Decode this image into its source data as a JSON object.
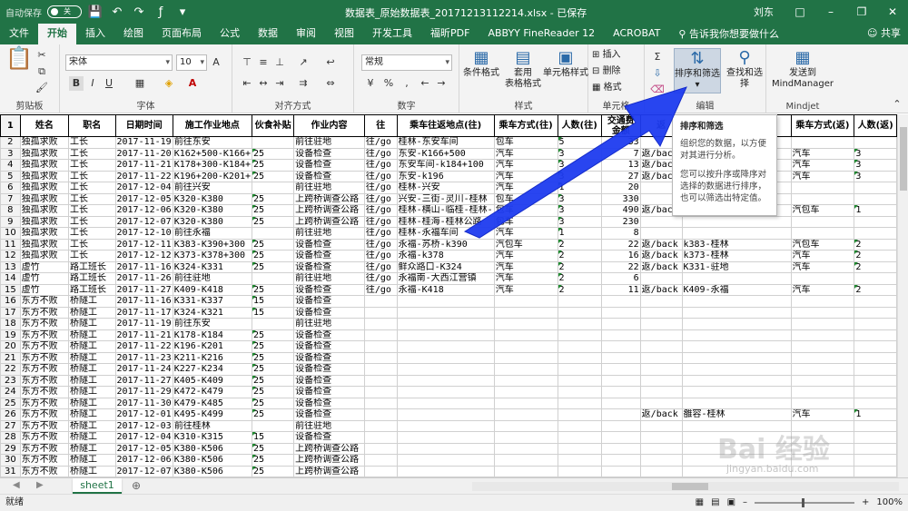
{
  "titlebar": {
    "autosave": "自动保存",
    "toggle": "关",
    "title": "数据表_原始数据表_20171213112214.xlsx - 已保存",
    "user": "刘东"
  },
  "tabs": [
    "文件",
    "开始",
    "插入",
    "绘图",
    "页面布局",
    "公式",
    "数据",
    "审阅",
    "视图",
    "开发工具",
    "福昕PDF",
    "ABBYY FineReader 12",
    "ACROBAT"
  ],
  "tellme": "告诉我你想要做什么",
  "share": "共享",
  "ribbon": {
    "clipboard": "剪贴板",
    "font": "字体",
    "font_name": "宋体",
    "font_size": "10",
    "alignment": "对齐方式",
    "number": "数字",
    "number_format": "常规",
    "styles": "样式",
    "cond_format": "条件格式",
    "table_format": "套用\n表格格式",
    "cell_style": "单元格样式",
    "cells": "单元格",
    "insert": "插入",
    "delete": "删除",
    "format": "格式",
    "edit": "编辑",
    "sort_filter": "排序和筛选",
    "find_select": "查找和选择",
    "mindjet": "Mindjet",
    "send_mm": "发送到\nMindManager"
  },
  "tooltip": {
    "title": "排序和筛选",
    "p1": "组织您的数据，以方便对其进行分析。",
    "p2": "您可以按升序或降序对选择的数据进行排序，也可以筛选出特定值。"
  },
  "headers": [
    "姓名",
    "职名",
    "日期时间",
    "施工作业地点",
    "伙食补贴",
    "作业内容",
    "往",
    "乘车往返地点(往)",
    "乘车方式(往)",
    "人数(往)",
    "交通费\n金额",
    "返",
    "",
    "乘车方式(返)",
    "人数(返)"
  ],
  "rows": [
    [
      "独孤求败",
      "工长",
      "2017-11-19",
      "前往东安",
      "",
      "前往驻地",
      "往/go",
      "桂林-东安车间",
      "包车",
      "5",
      "33",
      "",
      "",
      "",
      ""
    ],
    [
      "独孤求败",
      "工长",
      "2017-11-20",
      "K162+500-K166+",
      "25",
      "设备检查",
      "往/go",
      "东安-K166+500",
      "汽车",
      "3",
      "7",
      "返/back",
      "",
      "汽车",
      "3"
    ],
    [
      "独孤求败",
      "工长",
      "2017-11-21",
      "K178+300-K184+",
      "25",
      "设备检查",
      "往/go",
      "东安车间-k184+100",
      "汽车",
      "3",
      "13",
      "返/back",
      "",
      "汽车",
      "3"
    ],
    [
      "独孤求败",
      "工长",
      "2017-11-22",
      "K196+200-K201+",
      "25",
      "设备检查",
      "往/go",
      "东安-k196",
      "汽车",
      "3",
      "27",
      "返/back",
      "",
      "汽车",
      "3"
    ],
    [
      "独孤求败",
      "工长",
      "2017-12-04",
      "前往兴安",
      "",
      "前往驻地",
      "往/go",
      "桂林-兴安",
      "汽车",
      "1",
      "20",
      "",
      "",
      "",
      ""
    ],
    [
      "独孤求败",
      "工长",
      "2017-12-05",
      "K320-K380",
      "25",
      "上跨桥调查公路",
      "往/go",
      "兴安-三街-灵川-桂林",
      "包车",
      "3",
      "330",
      "",
      "",
      "",
      ""
    ],
    [
      "独孤求败",
      "工长",
      "2017-12-06",
      "K320-K380",
      "25",
      "上跨桥调查公路",
      "往/go",
      "桂林-横山-临桂-桂林-",
      "包车",
      "3",
      "490",
      "返/back",
      "",
      "汽包车",
      "1"
    ],
    [
      "独孤求败",
      "工长",
      "2017-12-07",
      "K320-K380",
      "25",
      "上跨桥调查公路",
      "往/go",
      "桂林-桂海-桂林公路",
      "包车",
      "3",
      "230",
      "",
      "",
      "",
      ""
    ],
    [
      "独孤求败",
      "工长",
      "2017-12-10",
      "前往永福",
      "",
      "前往驻地",
      "往/go",
      "桂林-永福车间",
      "汽车",
      "1",
      "8",
      "",
      "",
      "",
      ""
    ],
    [
      "独孤求败",
      "工长",
      "2017-12-11",
      "K383-K390+300",
      "25",
      "设备检查",
      "往/go",
      "永福-苏桥-k390",
      "汽包车",
      "2",
      "22",
      "返/back",
      "k383-桂林",
      "汽包车",
      "2"
    ],
    [
      "独孤求败",
      "工长",
      "2017-12-12",
      "K373-K378+300",
      "25",
      "设备检查",
      "往/go",
      "永福-k378",
      "汽车",
      "2",
      "16",
      "返/back",
      "k373-桂林",
      "汽车",
      "2"
    ],
    [
      "虚竹",
      "路工班长",
      "2017-11-16",
      "K324-K331",
      "25",
      "设备检查",
      "往/go",
      "鲜众路口-K324",
      "汽车",
      "2",
      "22",
      "返/back",
      "K331-驻地",
      "汽车",
      "2"
    ],
    [
      "虚竹",
      "路工班长",
      "2017-11-26",
      "前往驻地",
      "",
      "前往驻地",
      "往/go",
      "永福南-大西江营镇",
      "汽车",
      "2",
      "6",
      "",
      "",
      "",
      ""
    ],
    [
      "虚竹",
      "路工班长",
      "2017-11-27",
      "K409-K418",
      "25",
      "设备检查",
      "往/go",
      "永福-K418",
      "汽车",
      "2",
      "11",
      "返/back",
      "K409-永福",
      "汽车",
      "2"
    ],
    [
      "东方不败",
      "桥隧工",
      "2017-11-16",
      "K331-K337",
      "15",
      "设备检查",
      "",
      "",
      "",
      "",
      "",
      "",
      "",
      "",
      ""
    ],
    [
      "东方不败",
      "桥隧工",
      "2017-11-17",
      "K324-K321",
      "15",
      "设备检查",
      "",
      "",
      "",
      "",
      "",
      "",
      "",
      "",
      ""
    ],
    [
      "东方不败",
      "桥隧工",
      "2017-11-19",
      "前往东安",
      "",
      "前往驻地",
      "",
      "",
      "",
      "",
      "",
      "",
      "",
      "",
      ""
    ],
    [
      "东方不败",
      "桥隧工",
      "2017-11-21",
      "K178-K184",
      "25",
      "设备检查",
      "",
      "",
      "",
      "",
      "",
      "",
      "",
      "",
      ""
    ],
    [
      "东方不败",
      "桥隧工",
      "2017-11-22",
      "K196-K201",
      "25",
      "设备检查",
      "",
      "",
      "",
      "",
      "",
      "",
      "",
      "",
      ""
    ],
    [
      "东方不败",
      "桥隧工",
      "2017-11-23",
      "K211-K216",
      "25",
      "设备检查",
      "",
      "",
      "",
      "",
      "",
      "",
      "",
      "",
      ""
    ],
    [
      "东方不败",
      "桥隧工",
      "2017-11-24",
      "K227-K234",
      "25",
      "设备检查",
      "",
      "",
      "",
      "",
      "",
      "",
      "",
      "",
      ""
    ],
    [
      "东方不败",
      "桥隧工",
      "2017-11-27",
      "K405-K409",
      "25",
      "设备检查",
      "",
      "",
      "",
      "",
      "",
      "",
      "",
      "",
      ""
    ],
    [
      "东方不败",
      "桥隧工",
      "2017-11-29",
      "K472-K479",
      "25",
      "设备检查",
      "",
      "",
      "",
      "",
      "",
      "",
      "",
      "",
      ""
    ],
    [
      "东方不败",
      "桥隧工",
      "2017-11-30",
      "K479-K485",
      "25",
      "设备检查",
      "",
      "",
      "",
      "",
      "",
      "",
      "",
      "",
      ""
    ],
    [
      "东方不败",
      "桥隧工",
      "2017-12-01",
      "K495-K499",
      "25",
      "设备检查",
      "",
      "",
      "",
      "",
      "",
      "返/back",
      "雒容-桂林",
      "汽车",
      "1"
    ],
    [
      "东方不败",
      "桥隧工",
      "2017-12-03",
      "前往桂林",
      "",
      "前往驻地",
      "",
      "",
      "",
      "",
      "",
      "",
      "",
      "",
      ""
    ],
    [
      "东方不败",
      "桥隧工",
      "2017-12-04",
      "K310-K315",
      "15",
      "设备检查",
      "",
      "",
      "",
      "",
      "",
      "",
      "",
      "",
      ""
    ],
    [
      "东方不败",
      "桥隧工",
      "2017-12-05",
      "K380-K506",
      "25",
      "上跨桥调查公路",
      "",
      "",
      "",
      "",
      "",
      "",
      "",
      "",
      ""
    ],
    [
      "东方不败",
      "桥隧工",
      "2017-12-06",
      "K380-K506",
      "25",
      "上跨桥调查公路",
      "",
      "",
      "",
      "",
      "",
      "",
      "",
      "",
      ""
    ],
    [
      "东方不败",
      "桥隧工",
      "2017-12-07",
      "K380-K506",
      "25",
      "上跨桥调查公路",
      "",
      "",
      "",
      "",
      "",
      "",
      "",
      "",
      ""
    ]
  ],
  "sheet_tab": "sheet1",
  "status": {
    "ready": "就绪",
    "zoom": "100%"
  },
  "watermark": {
    "logo": "Bai 经验",
    "url": "jingyan.baidu.com"
  }
}
